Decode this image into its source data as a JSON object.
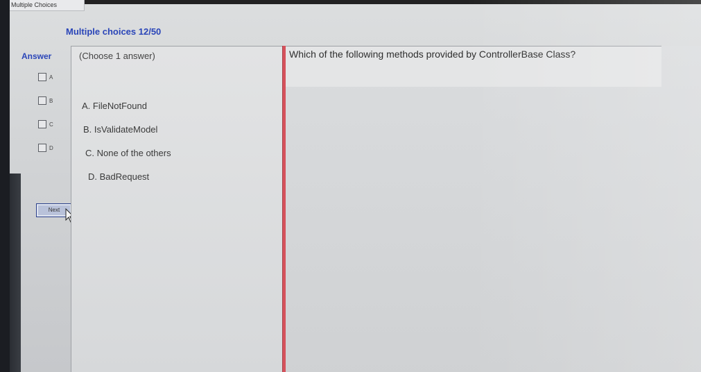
{
  "window": {
    "tab_title": "Multiple Choices"
  },
  "header": {
    "title": "Multiple choices 12/50"
  },
  "answer_panel": {
    "label": "Answer",
    "items": [
      {
        "letter": "A"
      },
      {
        "letter": "B"
      },
      {
        "letter": "C"
      },
      {
        "letter": "D"
      }
    ],
    "next_label": "Next"
  },
  "options_panel": {
    "instruction": "(Choose 1 answer)",
    "options": [
      {
        "text": "A. FileNotFound"
      },
      {
        "text": "B. IsValidateModel"
      },
      {
        "text": "C. None of the others"
      },
      {
        "text": "D. BadRequest"
      }
    ]
  },
  "question": {
    "text": "Which of the following methods provided by ControllerBase Class?"
  },
  "colors": {
    "accent_blue": "#2a45b8",
    "divider_red": "#d6525c"
  }
}
